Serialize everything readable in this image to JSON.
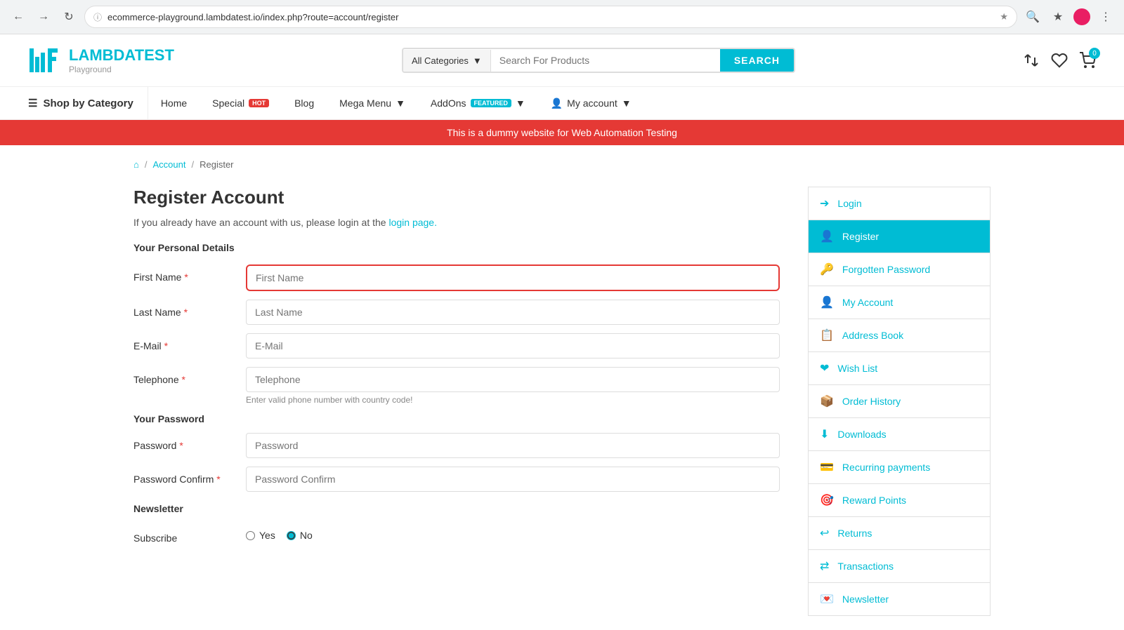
{
  "browser": {
    "url": "ecommerce-playground.lambdatest.io/index.php?route=account/register",
    "nav_back": "←",
    "nav_forward": "→",
    "nav_refresh": "↻"
  },
  "header": {
    "logo_main": "LAMBDATEST",
    "logo_sub": "Playground",
    "search_placeholder": "Search For Products",
    "search_category": "All Categories",
    "search_btn": "SEARCH",
    "cart_count": "0"
  },
  "nav": {
    "shop_by_category": "Shop by Category",
    "links": [
      {
        "label": "Home",
        "badge": null
      },
      {
        "label": "Special",
        "badge": "Hot"
      },
      {
        "label": "Blog",
        "badge": null
      },
      {
        "label": "Mega Menu",
        "badge": null,
        "has_dropdown": true
      },
      {
        "label": "AddOns",
        "badge": "Featured",
        "has_dropdown": true
      },
      {
        "label": "My account",
        "badge": null,
        "has_dropdown": true
      }
    ]
  },
  "banner": {
    "text": "This is a dummy website for Web Automation Testing"
  },
  "breadcrumb": {
    "home_icon": "⌂",
    "account_label": "Account",
    "register_label": "Register"
  },
  "form": {
    "title": "Register Account",
    "intro_text": "If you already have an account with us, please login at the",
    "login_link": "login page.",
    "personal_details_label": "Your Personal Details",
    "first_name_label": "First Name",
    "first_name_required": "*",
    "first_name_placeholder": "First Name",
    "last_name_label": "Last Name",
    "last_name_required": "*",
    "last_name_placeholder": "Last Name",
    "email_label": "E-Mail",
    "email_required": "*",
    "email_placeholder": "E-Mail",
    "telephone_label": "Telephone",
    "telephone_required": "*",
    "telephone_placeholder": "Telephone",
    "telephone_hint": "Enter valid phone number with country code!",
    "password_section_label": "Your Password",
    "password_label": "Password",
    "password_required": "*",
    "password_placeholder": "Password",
    "password_confirm_label": "Password Confirm",
    "password_confirm_required": "*",
    "password_confirm_placeholder": "Password Confirm",
    "newsletter_label": "Newsletter",
    "subscribe_label": "Subscribe",
    "yes_label": "Yes",
    "no_label": "No"
  },
  "sidebar": {
    "items": [
      {
        "label": "Login",
        "icon": "→",
        "active": false
      },
      {
        "label": "Register",
        "icon": "👤",
        "active": true
      },
      {
        "label": "Forgotten Password",
        "icon": "🔑",
        "active": false
      },
      {
        "label": "My Account",
        "icon": "👤",
        "active": false
      },
      {
        "label": "Address Book",
        "icon": "📋",
        "active": false
      },
      {
        "label": "Wish List",
        "icon": "♥",
        "active": false
      },
      {
        "label": "Order History",
        "icon": "📦",
        "active": false
      },
      {
        "label": "Downloads",
        "icon": "⬇",
        "active": false
      },
      {
        "label": "Recurring payments",
        "icon": "💳",
        "active": false
      },
      {
        "label": "Reward Points",
        "icon": "🎯",
        "active": false
      },
      {
        "label": "Returns",
        "icon": "↩",
        "active": false
      },
      {
        "label": "Transactions",
        "icon": "⇄",
        "active": false
      },
      {
        "label": "Newsletter",
        "icon": "📧",
        "active": false
      }
    ]
  }
}
